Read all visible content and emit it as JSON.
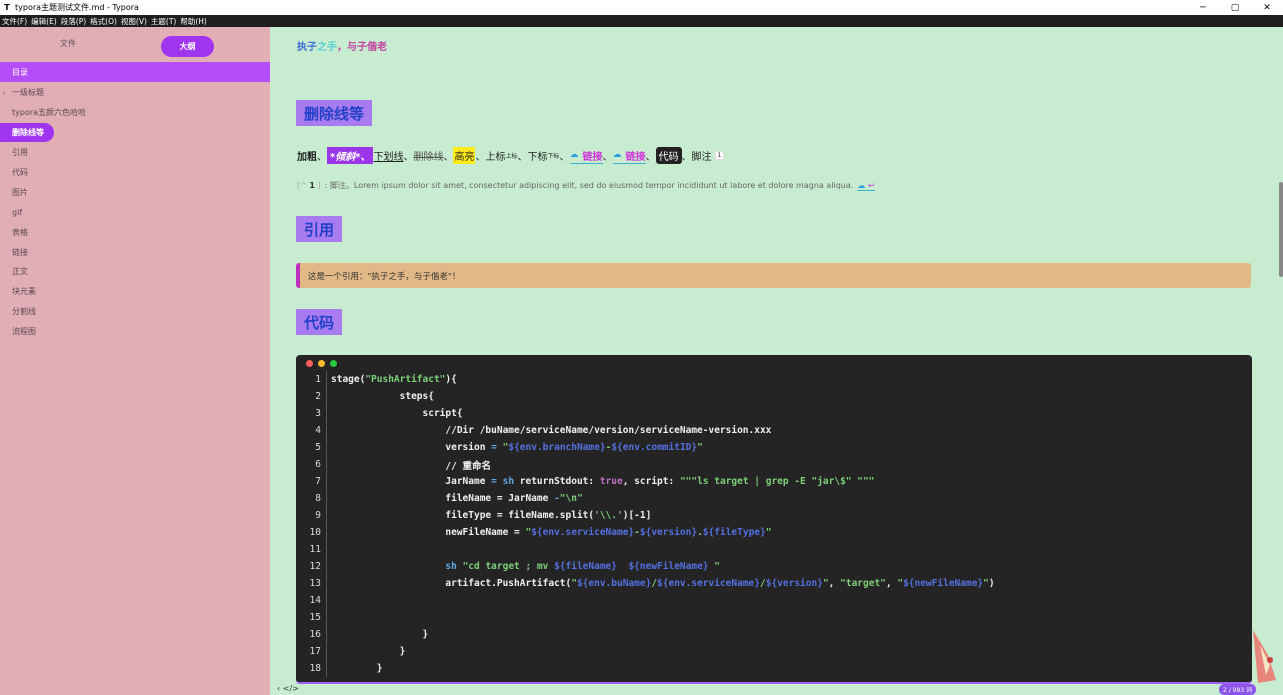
{
  "window": {
    "title": "typora主题测试文件.md - Typora",
    "app_icon": "T",
    "controls": [
      "─",
      "▢",
      "✕"
    ]
  },
  "menu": [
    "文件(F)",
    "编辑(E)",
    "段落(P)",
    "格式(O)",
    "视图(V)",
    "主题(T)",
    "帮助(H)"
  ],
  "sidebar": {
    "tab_files": "文件",
    "tab_outline": "大纲",
    "header": "目录",
    "items": [
      {
        "label": "一级标题",
        "caret": "›"
      },
      {
        "label": "typora五颜六色哈哈",
        "caret": ""
      },
      {
        "label": "删除线等",
        "caret": "",
        "active": true
      },
      {
        "label": "引用",
        "caret": ""
      },
      {
        "label": "代码",
        "caret": ""
      },
      {
        "label": "图片",
        "caret": ""
      },
      {
        "label": "gif",
        "caret": ""
      },
      {
        "label": "表格",
        "caret": ""
      },
      {
        "label": "链接",
        "caret": ""
      },
      {
        "label": "正文",
        "caret": ""
      },
      {
        "label": "块元素",
        "caret": ""
      },
      {
        "label": "分割线",
        "caret": ""
      },
      {
        "label": "流程图",
        "caret": ""
      }
    ]
  },
  "content": {
    "quote_top": {
      "a": "执子",
      "b": "之手",
      "c": "，与子偕老"
    },
    "h_strike": "删除线等",
    "inline": {
      "bold": "加粗",
      "sep": "、",
      "italic": "*倾斜*、",
      "underline": "下划线",
      "strike": "删除线",
      "highlight": "高亮",
      "sup_base": "上标",
      "sup": "上标",
      "sub_base": "下标",
      "sub": "下标",
      "link1": "链接",
      "link2": "链接",
      "code": "代码",
      "footnote_label": "脚注",
      "footnote_ref": "1"
    },
    "footnote": {
      "prefix": "[^",
      "id": "1",
      "suffix": "]",
      "text": ": 脚注。Lorem ipsum dolor sit amet, consectetur adipiscing elit, sed do eiusmod tempor incididunt ut labore et dolore magna aliqua.",
      "back": "↩"
    },
    "h_quote": "引用",
    "blockquote": "这是一个引用：\"执子之手，与子偕老\"！",
    "h_code": "代码"
  },
  "codeblock": {
    "dot_colors": [
      "#ff5f56",
      "#ffbd2e",
      "#27c93f"
    ],
    "lines": [
      {
        "n": "1",
        "parts": [
          [
            "",
            "stage("
          ],
          [
            "s",
            "\"PushArtifact\""
          ],
          [
            "",
            "){"
          ]
        ]
      },
      {
        "n": "2",
        "parts": [
          [
            "",
            "            steps{"
          ]
        ]
      },
      {
        "n": "3",
        "parts": [
          [
            "",
            "                script{"
          ]
        ]
      },
      {
        "n": "4",
        "parts": [
          [
            "",
            "                    //Dir /buName/serviceName/version/serviceName-version.xxx"
          ]
        ]
      },
      {
        "n": "5",
        "parts": [
          [
            "",
            "                    version "
          ],
          [
            "k",
            "= "
          ],
          [
            "s",
            "\""
          ],
          [
            "v",
            "${env.branchName}"
          ],
          [
            "s",
            "-"
          ],
          [
            "v",
            "${env.commitID}"
          ],
          [
            "s",
            "\""
          ]
        ]
      },
      {
        "n": "6",
        "parts": [
          [
            "",
            "                    // 重命名"
          ]
        ]
      },
      {
        "n": "7",
        "parts": [
          [
            "",
            "                    JarName "
          ],
          [
            "k",
            "= sh "
          ],
          [
            "",
            "returnStdout: "
          ],
          [
            "p",
            "true"
          ],
          [
            "",
            ", script: "
          ],
          [
            "s",
            "\"\"\"ls target | grep -E \"jar\\$\" \"\"\""
          ]
        ]
      },
      {
        "n": "8",
        "parts": [
          [
            "",
            "                    fileName = JarName "
          ],
          [
            "k",
            "-"
          ],
          [
            "s",
            "\"\\n\""
          ]
        ]
      },
      {
        "n": "9",
        "parts": [
          [
            "",
            "                    fileType = fileName.split("
          ],
          [
            "s",
            "'\\\\.'"
          ],
          [
            "",
            ")[-1]"
          ]
        ]
      },
      {
        "n": "10",
        "parts": [
          [
            "",
            "                    newFileName = "
          ],
          [
            "s",
            "\""
          ],
          [
            "v",
            "${env.serviceName}"
          ],
          [
            "s",
            "-"
          ],
          [
            "v",
            "${version}"
          ],
          [
            "s",
            "."
          ],
          [
            "v",
            "${fileType}"
          ],
          [
            "s",
            "\""
          ]
        ]
      },
      {
        "n": "11",
        "parts": [
          [
            "",
            ""
          ]
        ]
      },
      {
        "n": "12",
        "parts": [
          [
            "",
            "                    "
          ],
          [
            "k",
            "sh "
          ],
          [
            "s",
            "\"cd target ; mv "
          ],
          [
            "v",
            "${fileName}"
          ],
          [
            "s",
            "  "
          ],
          [
            "v",
            "${newFileName}"
          ],
          [
            "s",
            " \""
          ]
        ]
      },
      {
        "n": "13",
        "parts": [
          [
            "",
            "                    artifact.PushArtifact("
          ],
          [
            "s",
            "\""
          ],
          [
            "v",
            "${env.buName}"
          ],
          [
            "s",
            "/"
          ],
          [
            "v",
            "${env.serviceName}"
          ],
          [
            "s",
            "/"
          ],
          [
            "v",
            "${version}"
          ],
          [
            "s",
            "\""
          ],
          [
            "",
            ", "
          ],
          [
            "s",
            "\"target\""
          ],
          [
            "",
            ", "
          ],
          [
            "s",
            "\""
          ],
          [
            "v",
            "${newFileName}"
          ],
          [
            "s",
            "\""
          ],
          [
            "",
            ")"
          ]
        ]
      },
      {
        "n": "14",
        "parts": [
          [
            "",
            ""
          ]
        ]
      },
      {
        "n": "15",
        "parts": [
          [
            "",
            ""
          ]
        ]
      },
      {
        "n": "16",
        "parts": [
          [
            "",
            "                }"
          ]
        ]
      },
      {
        "n": "17",
        "parts": [
          [
            "",
            "            }"
          ]
        ]
      },
      {
        "n": "18",
        "parts": [
          [
            "",
            "        }"
          ]
        ]
      }
    ]
  },
  "status": {
    "left": "‹  </>",
    "word_count": "2 / 983 词"
  }
}
